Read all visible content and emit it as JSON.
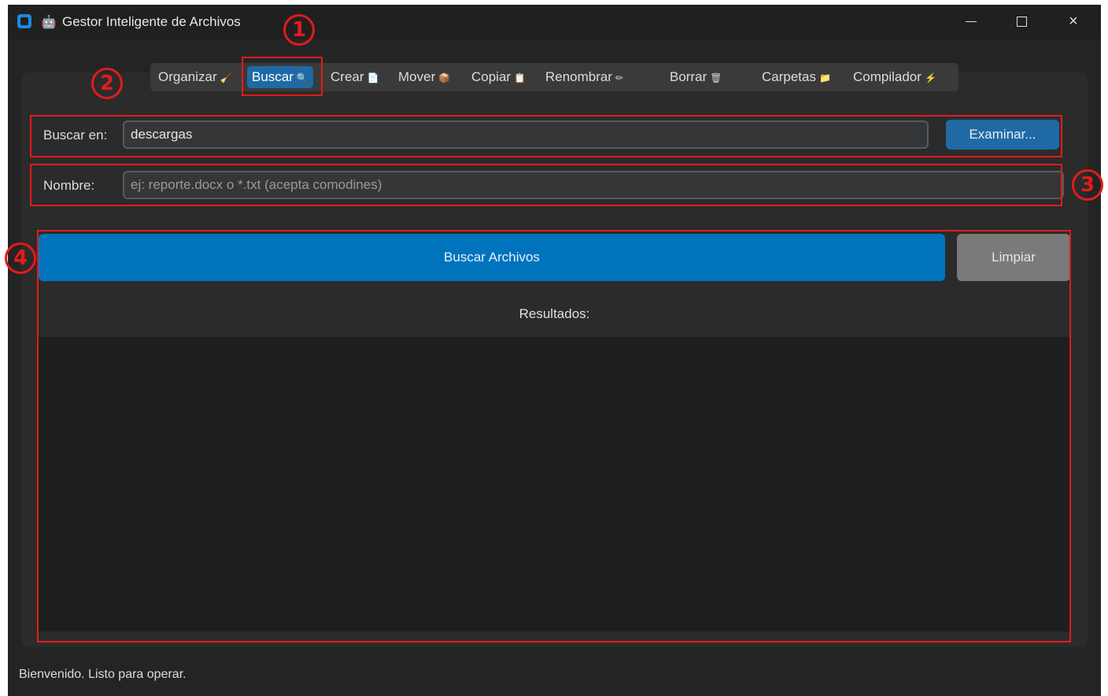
{
  "window": {
    "title": "Gestor Inteligente de Archivos",
    "title_emoji": "🤖",
    "controls": {
      "minimize": "minimize-icon",
      "maximize": "maximize-icon",
      "close": "×"
    }
  },
  "tabs": [
    {
      "label": "Organizar",
      "icon": "🧹"
    },
    {
      "label": "Buscar",
      "icon": "🔍",
      "active": true
    },
    {
      "label": "Crear",
      "icon": "📄"
    },
    {
      "label": "Mover",
      "icon": "📦"
    },
    {
      "label": "Copiar",
      "icon": "📋"
    },
    {
      "label": "Renombrar",
      "icon": "✏"
    },
    {
      "label": "Borrar",
      "icon": "🗑"
    },
    {
      "label": "Carpetas",
      "icon": "📁"
    },
    {
      "label": "Compilador",
      "icon": "⚡"
    }
  ],
  "search_in": {
    "label": "Buscar en:",
    "value": "descargas",
    "browse_label": "Examinar..."
  },
  "name_field": {
    "label": "Nombre:",
    "placeholder": "ej: reporte.docx o *.txt (acepta comodines)"
  },
  "actions": {
    "search_label": "Buscar Archivos",
    "clear_label": "Limpiar"
  },
  "results": {
    "label": "Resultados:"
  },
  "status_bar": {
    "text": "Bienvenido. Listo para operar."
  },
  "annotations": [
    "1",
    "2",
    "3",
    "4"
  ],
  "colors": {
    "accent": "#1f6aa5",
    "primary_button": "#0073bd",
    "annotation": "#e21b1b",
    "background": "#242424"
  }
}
